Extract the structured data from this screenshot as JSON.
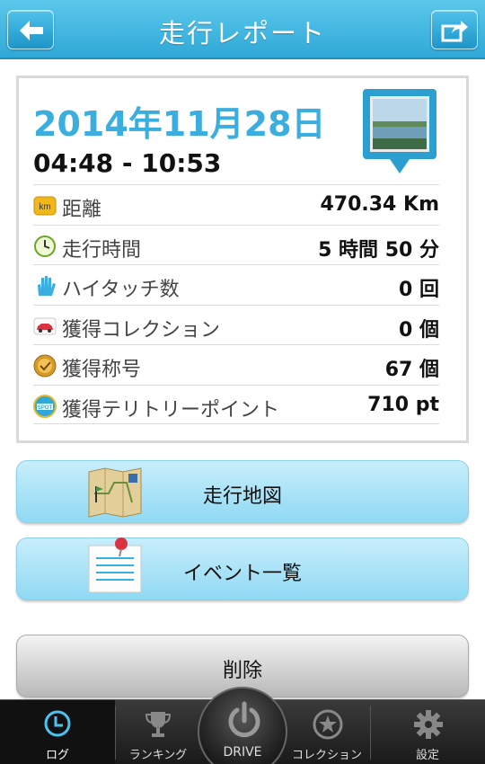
{
  "header": {
    "title": "走行レポート",
    "back_icon": "arrow-left-icon",
    "share_icon": "share-icon"
  },
  "report": {
    "date": "2014年11月28日",
    "time_range": "04:48 - 10:53",
    "rows": [
      {
        "icon": "km-icon",
        "label": "距離",
        "value": "470.34 Km"
      },
      {
        "icon": "clock-icon",
        "label": "走行時間",
        "value": "5 時間 50 分"
      },
      {
        "icon": "hand-icon",
        "label": "ハイタッチ数",
        "value": "0 回"
      },
      {
        "icon": "car-icon",
        "label": "獲得コレクション",
        "value": "0 個"
      },
      {
        "icon": "medal-icon",
        "label": "獲得称号",
        "value": "67 個"
      },
      {
        "icon": "spot-icon",
        "label": "獲得テリトリーポイント",
        "value": "710 pt"
      }
    ]
  },
  "buttons": {
    "map": "走行地図",
    "event": "イベント一覧",
    "delete": "削除"
  },
  "tabs": {
    "log": "ログ",
    "ranking": "ランキング",
    "drive": "DRIVE",
    "collection": "コレクション",
    "settings": "設定"
  },
  "colors": {
    "accent": "#3aaede",
    "header": "#2fa8d8",
    "button": "#a8e3f6"
  }
}
